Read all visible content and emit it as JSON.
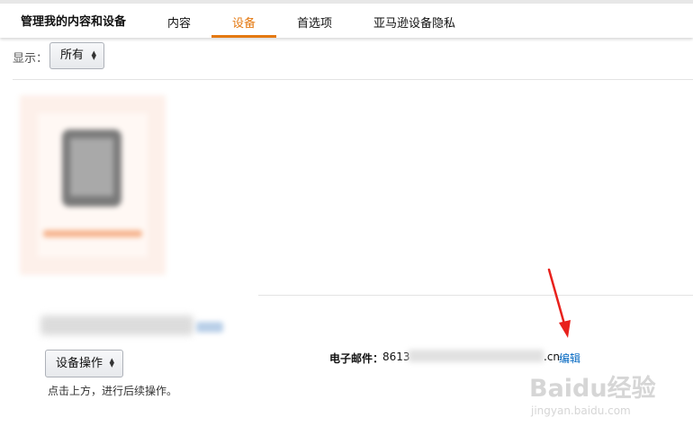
{
  "header": {
    "title": "管理我的内容和设备",
    "tabs": [
      {
        "label": "内容"
      },
      {
        "label": "设备",
        "active": true
      },
      {
        "label": "首选项"
      },
      {
        "label": "亚马逊设备隐私"
      }
    ],
    "accent_color": "#e47911"
  },
  "filter": {
    "label": "显示：",
    "selected": "所有"
  },
  "device_actions": {
    "button_label": "设备操作",
    "hint": "点击上方，进行后续操作。"
  },
  "email": {
    "label": "电子邮件：",
    "prefix": "8613",
    "suffix": ".cn",
    "edit_label": "编辑",
    "link_color": "#0066c0"
  },
  "annotation": {
    "arrow_color": "#e8211c"
  },
  "watermark": {
    "main": "Baidu经验",
    "sub": "jingyan.baidu.com"
  }
}
